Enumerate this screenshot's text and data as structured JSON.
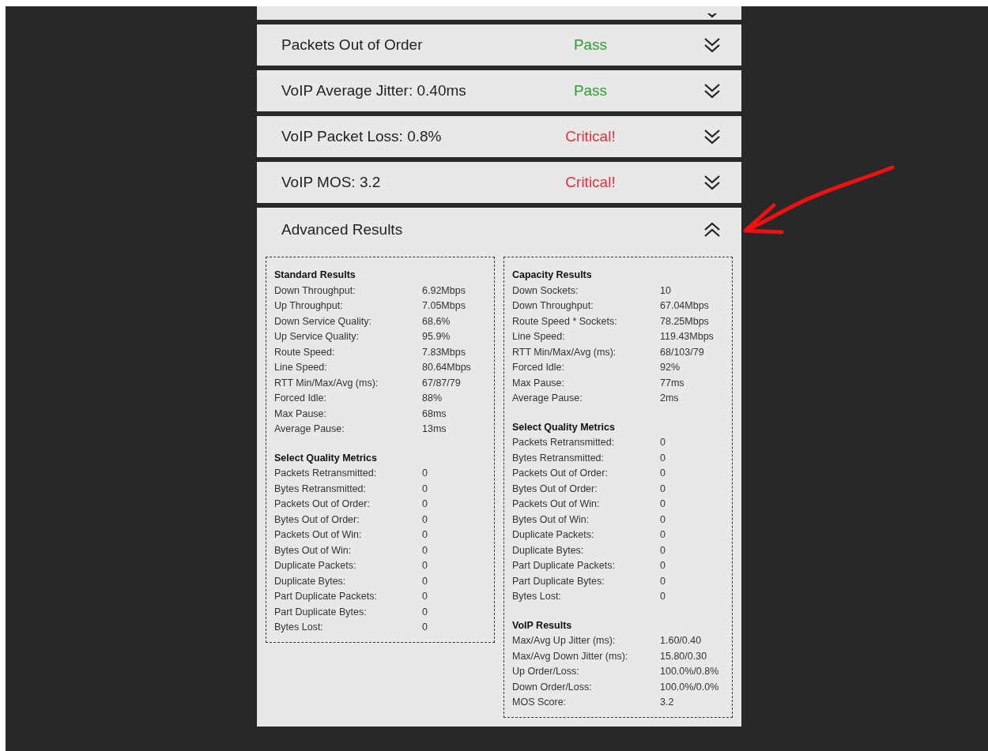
{
  "rows": [
    {
      "title": "Packets Out of Order",
      "status": "Pass",
      "color": "#2ca02c",
      "expanded": false
    },
    {
      "title": "VoIP Average Jitter: 0.40ms",
      "status": "Pass",
      "color": "#2ca02c",
      "expanded": false
    },
    {
      "title": "VoIP Packet Loss: 0.8%",
      "status": "Critical!",
      "color": "#e0323c",
      "expanded": false
    },
    {
      "title": "VoIP MOS: 3.2",
      "status": "Critical!",
      "color": "#e0323c",
      "expanded": false
    }
  ],
  "advanced": {
    "title": "Advanced Results",
    "expanded": true,
    "panels": [
      {
        "sections": [
          {
            "heading": "Standard Results",
            "items": [
              {
                "label": "Down Throughput:",
                "value": "6.92Mbps"
              },
              {
                "label": "Up Throughput:",
                "value": "7.05Mbps"
              },
              {
                "label": "Down Service Quality:",
                "value": "68.6%"
              },
              {
                "label": "Up Service Quality:",
                "value": "95.9%"
              },
              {
                "label": "Route Speed:",
                "value": "7.83Mbps"
              },
              {
                "label": "Line Speed:",
                "value": "80.64Mbps"
              },
              {
                "label": "RTT Min/Max/Avg (ms):",
                "value": "67/87/79"
              },
              {
                "label": "Forced Idle:",
                "value": "88%"
              },
              {
                "label": "Max Pause:",
                "value": "68ms"
              },
              {
                "label": "Average Pause:",
                "value": "13ms"
              }
            ]
          },
          {
            "heading": "Select Quality Metrics",
            "items": [
              {
                "label": "Packets Retransmitted:",
                "value": "0"
              },
              {
                "label": "Bytes Retransmitted:",
                "value": "0"
              },
              {
                "label": "Packets Out of Order:",
                "value": "0"
              },
              {
                "label": "Bytes Out of Order:",
                "value": "0"
              },
              {
                "label": "Packets Out of Win:",
                "value": "0"
              },
              {
                "label": "Bytes Out of Win:",
                "value": "0"
              },
              {
                "label": "Duplicate Packets:",
                "value": "0"
              },
              {
                "label": "Duplicate Bytes:",
                "value": "0"
              },
              {
                "label": "Part Duplicate Packets:",
                "value": "0"
              },
              {
                "label": "Part Duplicate Bytes:",
                "value": "0"
              },
              {
                "label": "Bytes Lost:",
                "value": "0"
              }
            ]
          }
        ]
      },
      {
        "sections": [
          {
            "heading": "Capacity Results",
            "items": [
              {
                "label": "Down Sockets:",
                "value": "10"
              },
              {
                "label": "Down Throughput:",
                "value": "67.04Mbps"
              },
              {
                "label": "Route Speed * Sockets:",
                "value": "78.25Mbps"
              },
              {
                "label": "Line Speed:",
                "value": "119.43Mbps"
              },
              {
                "label": "RTT Min/Max/Avg (ms):",
                "value": "68/103/79"
              },
              {
                "label": "Forced Idle:",
                "value": "92%"
              },
              {
                "label": "Max Pause:",
                "value": "77ms"
              },
              {
                "label": "Average Pause:",
                "value": "2ms"
              }
            ]
          },
          {
            "heading": "Select Quality Metrics",
            "items": [
              {
                "label": "Packets Retransmitted:",
                "value": "0"
              },
              {
                "label": "Bytes Retransmitted:",
                "value": "0"
              },
              {
                "label": "Packets Out of Order:",
                "value": "0"
              },
              {
                "label": "Bytes Out of Order:",
                "value": "0"
              },
              {
                "label": "Packets Out of Win:",
                "value": "0"
              },
              {
                "label": "Bytes Out of Win:",
                "value": "0"
              },
              {
                "label": "Duplicate Packets:",
                "value": "0"
              },
              {
                "label": "Duplicate Bytes:",
                "value": "0"
              },
              {
                "label": "Part Duplicate Packets:",
                "value": "0"
              },
              {
                "label": "Part Duplicate Bytes:",
                "value": "0"
              },
              {
                "label": "Bytes Lost:",
                "value": "0"
              }
            ]
          },
          {
            "heading": "VoIP Results",
            "items": [
              {
                "label": "Max/Avg Up Jitter (ms):",
                "value": "1.60/0.40"
              },
              {
                "label": "Max/Avg Down Jitter (ms):",
                "value": "15.80/0.30"
              },
              {
                "label": "Up Order/Loss:",
                "value": "100.0%/0.8%"
              },
              {
                "label": "Down Order/Loss:",
                "value": "100.0%/0.0%"
              },
              {
                "label": "MOS Score:",
                "value": "3.2"
              }
            ]
          }
        ]
      }
    ]
  }
}
